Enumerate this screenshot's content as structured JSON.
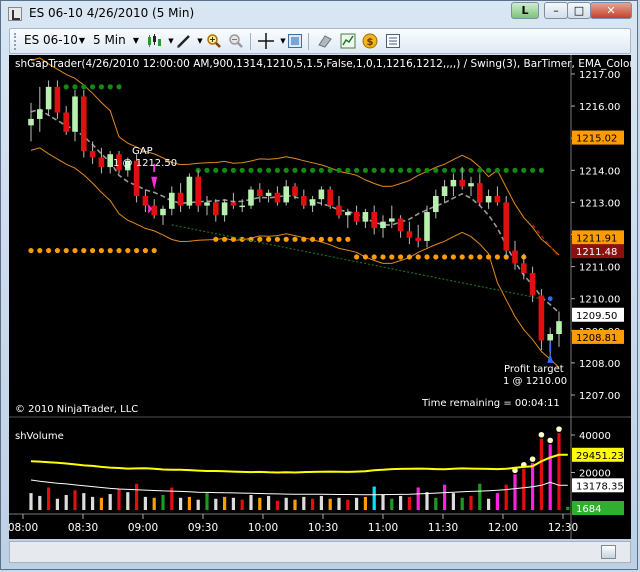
{
  "window": {
    "title": "ES 06-10  4/26/2010 (5 Min)",
    "link_label": "L",
    "minimize": "–",
    "maximize": "□",
    "close": "✕"
  },
  "toolbar": {
    "instrument": "ES 06-10",
    "interval": "5 Min",
    "icons": [
      "candlestick-icon",
      "pen-icon",
      "zoom-in-icon",
      "zoom-out-icon",
      "crosshair-icon",
      "data-box-icon",
      "template-icon",
      "indicators-icon",
      "strategies-icon",
      "properties-icon"
    ]
  },
  "price_panel": {
    "indicator_label": "shGapTrader(4/26/2010 12:00:00 AM,900,1314,1210,5,1.5,False,1,0,1,1216,1212,,,,) / Swing(3), BarTimer, EMA_Colors(Close",
    "gap_label": "GAP",
    "gap_entry": "1 @ 1212.50",
    "profit_label": "Profit target",
    "profit_fill": "1 @ 1210.00",
    "copyright": "© 2010 NinjaTrader, LLC",
    "time_remaining": "Time remaining = 00:04:11",
    "y_axis_labels": [
      "1217.00",
      "1216.00",
      "1215.00",
      "1214.00",
      "1213.00",
      "1212.00",
      "1211.00",
      "1210.00",
      "1209.00",
      "1208.00",
      "1207.00"
    ],
    "price_tags": [
      {
        "text": "1215.02",
        "bg": "#ff9d00",
        "fg": "#000000"
      },
      {
        "text": "1211.91",
        "bg": "#ff9d00",
        "fg": "#000000"
      },
      {
        "text": "1211.48",
        "bg": "#8b1111",
        "fg": "#ffffff"
      },
      {
        "text": "1209.50",
        "bg": "#ffffff",
        "fg": "#000000"
      },
      {
        "text": "1208.81",
        "bg": "#ff9d00",
        "fg": "#000000"
      }
    ],
    "chart_data": {
      "type": "candlestick",
      "x_range": [
        "08:00",
        "12:35"
      ],
      "ylim": [
        1206.7,
        1217.3
      ],
      "bars": [
        {
          "o": 1209.0,
          "h": 1209.6,
          "l": 1208.5,
          "c": 1209.3,
          "color": "green"
        }
      ],
      "series_bars": [
        [
          1215.4,
          1216.1,
          1214.9,
          1215.6,
          "g"
        ],
        [
          1215.6,
          1216.6,
          1215.2,
          1215.9,
          "g"
        ],
        [
          1215.9,
          1216.8,
          1215.7,
          1216.6,
          "g"
        ],
        [
          1216.6,
          1216.8,
          1215.6,
          1215.8,
          "r"
        ],
        [
          1215.8,
          1216.0,
          1215.1,
          1215.2,
          "r"
        ],
        [
          1215.2,
          1216.5,
          1214.9,
          1216.3,
          "g"
        ],
        [
          1216.3,
          1216.5,
          1214.4,
          1214.6,
          "r"
        ],
        [
          1214.6,
          1214.9,
          1214.2,
          1214.4,
          "r"
        ],
        [
          1214.4,
          1214.7,
          1213.9,
          1214.1,
          "r"
        ],
        [
          1214.1,
          1214.6,
          1213.9,
          1214.5,
          "g"
        ],
        [
          1214.5,
          1214.6,
          1213.9,
          1214.0,
          "r"
        ],
        [
          1214.0,
          1214.4,
          1213.8,
          1214.3,
          "g"
        ],
        [
          1214.3,
          1214.5,
          1213.0,
          1213.2,
          "r"
        ],
        [
          1213.2,
          1213.4,
          1212.7,
          1212.9,
          "r"
        ],
        [
          1212.9,
          1213.1,
          1212.5,
          1212.6,
          "r"
        ],
        [
          1212.6,
          1212.9,
          1212.3,
          1212.8,
          "g"
        ],
        [
          1212.8,
          1213.5,
          1212.6,
          1213.3,
          "g"
        ],
        [
          1213.3,
          1213.6,
          1212.7,
          1212.9,
          "r"
        ],
        [
          1212.9,
          1213.9,
          1212.8,
          1213.8,
          "g"
        ],
        [
          1213.8,
          1214.0,
          1212.7,
          1212.9,
          "r"
        ],
        [
          1212.9,
          1213.2,
          1212.6,
          1213.0,
          "g"
        ],
        [
          1213.0,
          1213.1,
          1212.4,
          1212.6,
          "r"
        ],
        [
          1212.6,
          1213.1,
          1212.4,
          1213.0,
          "g"
        ],
        [
          1213.0,
          1213.3,
          1212.8,
          1212.9,
          "r"
        ],
        [
          1212.9,
          1213.1,
          1212.7,
          1212.9,
          "g"
        ],
        [
          1212.9,
          1213.5,
          1212.8,
          1213.4,
          "g"
        ],
        [
          1213.4,
          1213.6,
          1213.0,
          1213.2,
          "r"
        ],
        [
          1213.2,
          1213.4,
          1213.0,
          1213.3,
          "g"
        ],
        [
          1213.3,
          1213.5,
          1212.9,
          1213.0,
          "r"
        ],
        [
          1213.0,
          1213.7,
          1212.9,
          1213.5,
          "g"
        ],
        [
          1213.5,
          1213.6,
          1213.1,
          1213.2,
          "r"
        ],
        [
          1213.2,
          1213.4,
          1212.8,
          1212.9,
          "r"
        ],
        [
          1212.9,
          1213.2,
          1212.7,
          1213.1,
          "g"
        ],
        [
          1213.1,
          1213.5,
          1212.9,
          1213.4,
          "g"
        ],
        [
          1213.4,
          1213.5,
          1212.8,
          1212.9,
          "r"
        ],
        [
          1212.9,
          1213.2,
          1212.5,
          1212.6,
          "r"
        ],
        [
          1212.6,
          1212.8,
          1212.2,
          1212.7,
          "g"
        ],
        [
          1212.7,
          1212.9,
          1212.3,
          1212.4,
          "r"
        ],
        [
          1212.4,
          1212.8,
          1212.2,
          1212.7,
          "g"
        ],
        [
          1212.7,
          1212.9,
          1212.0,
          1212.2,
          "r"
        ],
        [
          1212.2,
          1212.6,
          1211.9,
          1212.4,
          "g"
        ],
        [
          1212.4,
          1212.9,
          1212.2,
          1212.5,
          "g"
        ],
        [
          1212.5,
          1212.6,
          1211.9,
          1212.1,
          "r"
        ],
        [
          1212.1,
          1212.4,
          1211.7,
          1211.9,
          "r"
        ],
        [
          1211.9,
          1212.3,
          1211.6,
          1211.8,
          "r"
        ],
        [
          1211.8,
          1212.9,
          1211.6,
          1212.7,
          "g"
        ],
        [
          1212.7,
          1213.4,
          1212.5,
          1213.2,
          "g"
        ],
        [
          1213.2,
          1213.7,
          1213.0,
          1213.5,
          "g"
        ],
        [
          1213.5,
          1213.9,
          1213.2,
          1213.7,
          "g"
        ],
        [
          1213.7,
          1214.1,
          1213.4,
          1213.5,
          "r"
        ],
        [
          1213.5,
          1213.8,
          1213.2,
          1213.6,
          "g"
        ],
        [
          1213.6,
          1213.9,
          1212.9,
          1213.0,
          "r"
        ],
        [
          1213.0,
          1213.4,
          1212.8,
          1213.2,
          "g"
        ],
        [
          1213.2,
          1213.5,
          1212.9,
          1213.0,
          "r"
        ],
        [
          1213.0,
          1213.2,
          1211.3,
          1211.5,
          "r"
        ],
        [
          1211.5,
          1211.8,
          1210.9,
          1211.1,
          "r"
        ],
        [
          1211.1,
          1211.4,
          1210.6,
          1210.8,
          "r"
        ],
        [
          1210.8,
          1211.0,
          1209.9,
          1210.1,
          "r"
        ],
        [
          1210.1,
          1210.3,
          1208.4,
          1208.7,
          "r"
        ],
        [
          1208.7,
          1209.1,
          1208.1,
          1208.9,
          "g"
        ],
        [
          1208.9,
          1209.6,
          1208.5,
          1209.3,
          "g"
        ]
      ]
    }
  },
  "volume_panel": {
    "label": "shVolume",
    "y_axis_labels": [
      "40000",
      "20000"
    ],
    "tags": [
      {
        "text": "29451.23",
        "bg": "#ffff00",
        "fg": "#000000"
      },
      {
        "text": "13178.35",
        "bg": "#ffffff",
        "fg": "#000000"
      },
      {
        "text": "1684",
        "bg": "#2fae2f",
        "fg": "#ffffff"
      }
    ],
    "chart_data": {
      "type": "bar",
      "ylim": [
        0,
        45000
      ],
      "values": [
        9000,
        7500,
        12000,
        6000,
        8000,
        10500,
        9000,
        7000,
        6500,
        8500,
        11000,
        9500,
        14000,
        7000,
        6500,
        8000,
        12000,
        6500,
        7000,
        5500,
        9000,
        6000,
        7000,
        6500,
        5500,
        8000,
        6500,
        7500,
        5000,
        6500,
        5500,
        7000,
        6000,
        7500,
        6000,
        6500,
        5500,
        6500,
        7000,
        12500,
        8000,
        6000,
        7500,
        7000,
        12000,
        9500,
        6500,
        13500,
        9000,
        6500,
        7500,
        14000,
        6000,
        9000,
        13500,
        19000,
        22000,
        25000,
        38000,
        35000,
        41000,
        1684
      ],
      "colors": [
        "w",
        "w",
        "r",
        "w",
        "w",
        "r",
        "w",
        "w",
        "o",
        "w",
        "r",
        "w",
        "r",
        "w",
        "o",
        "g",
        "r",
        "w",
        "o",
        "w",
        "g",
        "w",
        "o",
        "w",
        "r",
        "w",
        "o",
        "w",
        "r",
        "w",
        "o",
        "w",
        "r",
        "w",
        "o",
        "w",
        "r",
        "w",
        "o",
        "c",
        "w",
        "g",
        "w",
        "r",
        "m",
        "w",
        "g",
        "m",
        "w",
        "g",
        "r",
        "g",
        "w",
        "m",
        "r",
        "m",
        "r",
        "m",
        "r",
        "m",
        "r",
        "g"
      ],
      "sma_slow": [
        26000,
        25800,
        25500,
        25200,
        24800,
        24300,
        23800,
        23500,
        23000,
        22600,
        22400,
        22100,
        22200,
        22300,
        22000,
        21600,
        21500,
        21500,
        21300,
        21000,
        20800,
        20800,
        20700,
        20500,
        20300,
        20200,
        20300,
        20100,
        20000,
        20100,
        20000,
        20200,
        20300,
        20400,
        20500,
        20400,
        20300,
        20500,
        20700,
        21200,
        21500,
        21800,
        21900,
        22000,
        22100,
        22000,
        21800,
        21700,
        22000,
        22200,
        22100,
        22000,
        21900,
        21800,
        22000,
        22500,
        23000,
        23300,
        26000,
        28000,
        29451,
        29451
      ],
      "sma_fast": [
        16000,
        15300,
        14800,
        14300,
        13900,
        13400,
        12900,
        12500,
        12000,
        11500,
        11200,
        11000,
        10800,
        10600,
        10400,
        10200,
        10100,
        9900,
        9700,
        9500,
        9400,
        9300,
        9200,
        9100,
        9000,
        8900,
        8800,
        8700,
        8600,
        8500,
        8450,
        8400,
        8380,
        8350,
        8300,
        8280,
        8250,
        8200,
        8150,
        8180,
        8200,
        8250,
        8300,
        8400,
        8600,
        8800,
        9000,
        9300,
        9500,
        9700,
        9900,
        10100,
        10300,
        10500,
        10900,
        11400,
        11900,
        12400,
        13200,
        14800,
        13178,
        13178
      ]
    }
  },
  "time_axis": {
    "labels": [
      "08:00",
      "08:30",
      "09:00",
      "09:30",
      "10:00",
      "10:30",
      "11:00",
      "11:30",
      "12:00",
      "12:30"
    ]
  },
  "colors": {
    "background": "#000000",
    "bull": "#b8f0b0",
    "bear": "#e01010",
    "bands": "#e08a1e",
    "ema": "#9a9a9a",
    "target_line": "#1a6e1a",
    "dots_green": "#138a13",
    "dots_orange": "#ff9d00",
    "volume_sma_slow": "#ffff00",
    "volume_sma_fast": "#ffffff"
  }
}
